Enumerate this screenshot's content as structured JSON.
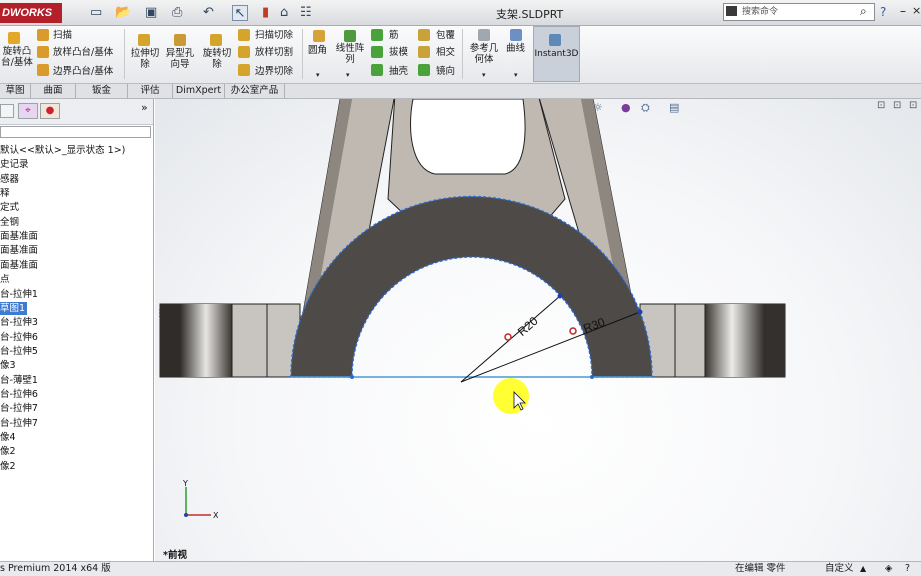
{
  "app": {
    "logo": "DWORKS",
    "document_title": "支架.SLDPRT"
  },
  "search": {
    "placeholder": "搜索命令"
  },
  "ribbon": {
    "left_group": {
      "revolve_boss": "旋转凸\n台/基体",
      "sweep": "扫描",
      "loft": "放样凸台/基体",
      "boundary": "边界凸台/基体"
    },
    "extrude_cut": "拉伸切\n除",
    "hole_wizard": "异型孔\n向导",
    "revolve_cut": "旋转切\n除",
    "sweep_cut": "扫描切除",
    "loft_cut": "放样切割",
    "boundary_cut": "边界切除",
    "fillet": "圆角",
    "linear_pattern": "线性阵\n列",
    "rib": "筋",
    "draft": "拔模",
    "shell": "抽壳",
    "wrap": "包覆",
    "intersect": "相交",
    "mirror": "镜向",
    "ref_geometry": "参考几\n何体",
    "curves": "曲线",
    "instant3d": "Instant3D"
  },
  "tabs": [
    "草图",
    "曲面",
    "钣金",
    "评估",
    "DimXpert",
    "办公室产品"
  ],
  "feature_tree": [
    {
      "text": "默认<<默认>_显示状态 1>)",
      "selected": false
    },
    {
      "text": "史记录",
      "selected": false
    },
    {
      "text": "感器",
      "selected": false
    },
    {
      "text": "释",
      "selected": false
    },
    {
      "text": "定式",
      "selected": false
    },
    {
      "text": "全钢",
      "selected": false
    },
    {
      "text": "面基准面",
      "selected": false
    },
    {
      "text": "面基准面",
      "selected": false
    },
    {
      "text": "面基准面",
      "selected": false
    },
    {
      "text": "点",
      "selected": false
    },
    {
      "text": "台-拉伸1",
      "selected": false
    },
    {
      "text": "草图1",
      "selected": true
    },
    {
      "text": "台-拉伸3",
      "selected": false
    },
    {
      "text": "台-拉伸6",
      "selected": false
    },
    {
      "text": "台-拉伸5",
      "selected": false
    },
    {
      "text": "像3",
      "selected": false
    },
    {
      "text": "台-薄壁1",
      "selected": false
    },
    {
      "text": "台-拉伸6",
      "selected": false
    },
    {
      "text": "台-拉伸7",
      "selected": false
    },
    {
      "text": "台-拉伸7",
      "selected": false
    },
    {
      "text": "像4",
      "selected": false
    },
    {
      "text": "像2",
      "selected": false
    },
    {
      "text": "像2",
      "selected": false
    }
  ],
  "viewport": {
    "view_name": "*前视",
    "dimensions": [
      "R20",
      "R30"
    ],
    "triad": {
      "x": "X",
      "y": "Y"
    }
  },
  "status": {
    "product": "s Premium 2014 x64 版",
    "editing": "在编辑 零件",
    "custom": "自定义"
  },
  "colors": {
    "part_face": "#4d4a47",
    "part_side": "#8a847c",
    "sketch_blue": "#2a6bd6",
    "cursor_highlight": "#ffff00"
  }
}
